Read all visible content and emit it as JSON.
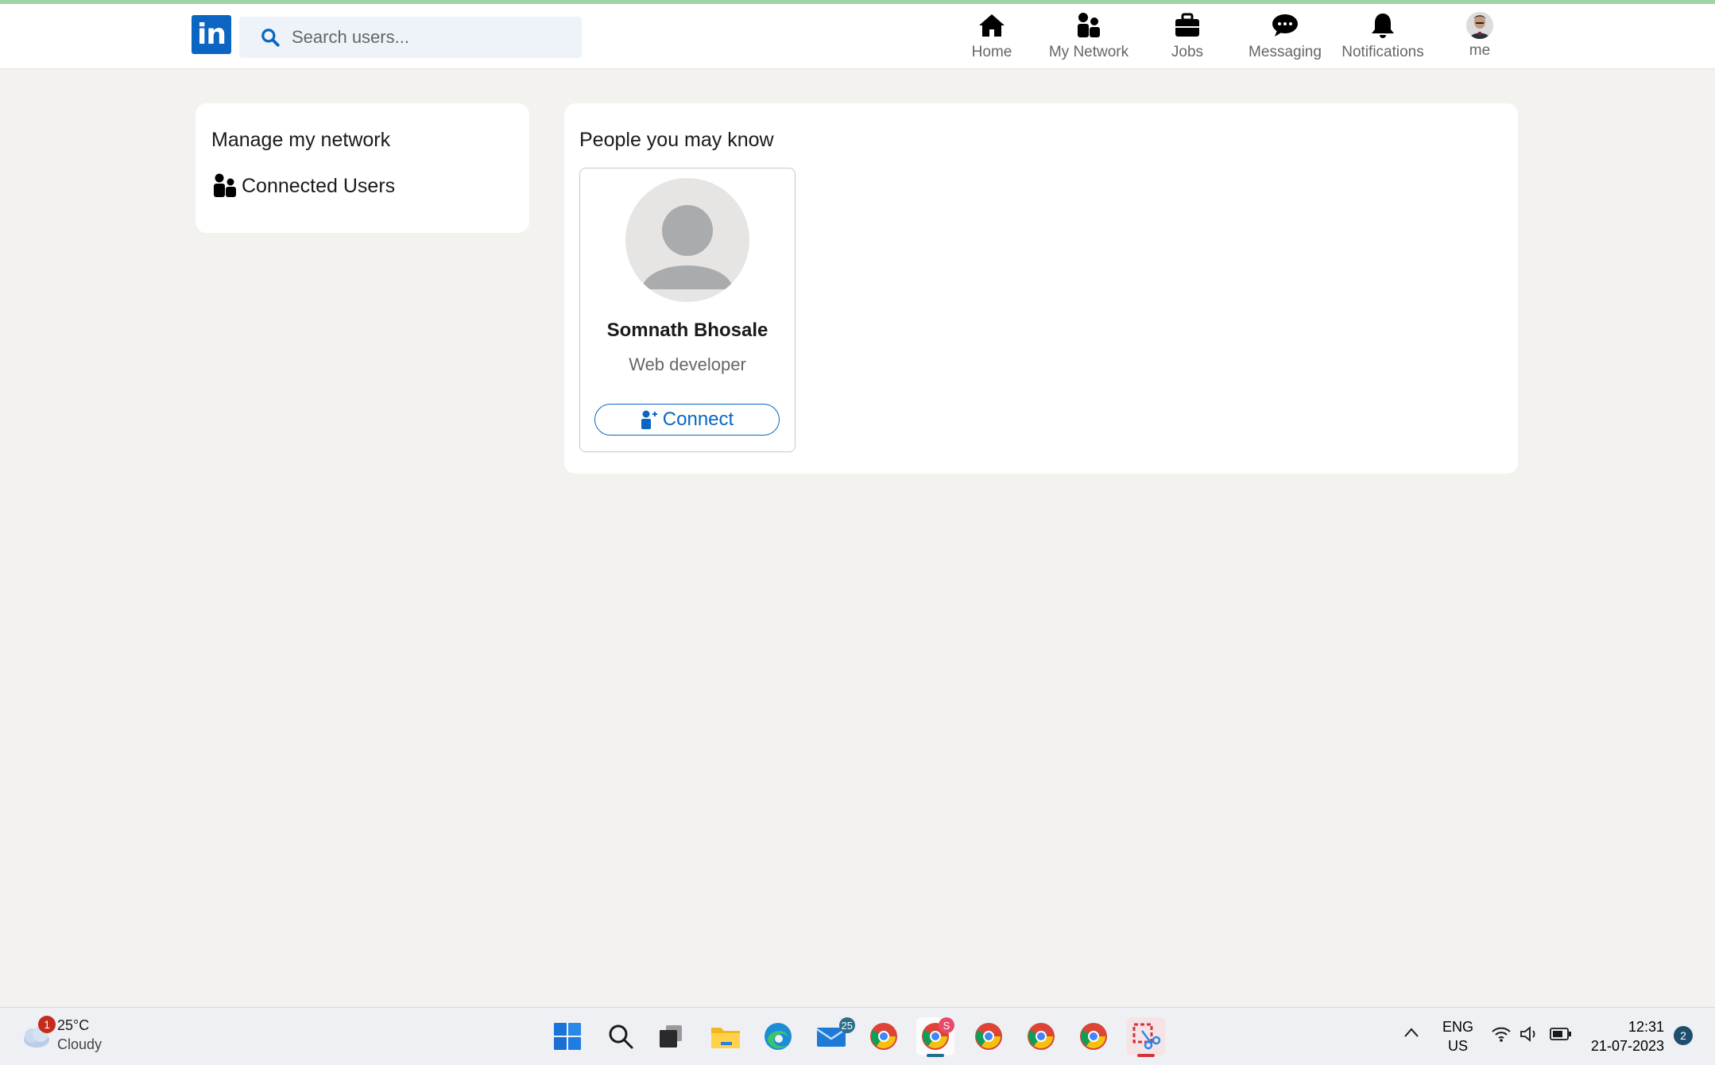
{
  "header": {
    "logo_text": "in",
    "search_placeholder": "Search users...",
    "nav": [
      {
        "label": "Home",
        "icon": "home-icon"
      },
      {
        "label": "My Network",
        "icon": "network-icon"
      },
      {
        "label": "Jobs",
        "icon": "briefcase-icon"
      },
      {
        "label": "Messaging",
        "icon": "message-icon"
      },
      {
        "label": "Notifications",
        "icon": "bell-icon"
      },
      {
        "label": "me",
        "icon": "avatar"
      }
    ]
  },
  "sidebar": {
    "title": "Manage my network",
    "connected_users_label": "Connected Users"
  },
  "main": {
    "title": "People you may know",
    "people": [
      {
        "name": "Somnath Bhosale",
        "role": "Web developer",
        "button_label": "Connect"
      }
    ]
  },
  "taskbar": {
    "weather": {
      "badge": "1",
      "temp": "25°C",
      "condition": "Cloudy"
    },
    "apps": [
      {
        "icon": "windows-start-icon"
      },
      {
        "icon": "search-icon"
      },
      {
        "icon": "task-view-icon"
      },
      {
        "icon": "file-explorer-icon"
      },
      {
        "icon": "edge-icon"
      },
      {
        "icon": "mail-icon",
        "badge": "25"
      },
      {
        "icon": "chrome-icon"
      },
      {
        "icon": "chrome-icon",
        "badge": "S",
        "active": true
      },
      {
        "icon": "chrome-icon"
      },
      {
        "icon": "chrome-icon"
      },
      {
        "icon": "chrome-icon"
      },
      {
        "icon": "snipping-tool-icon"
      }
    ],
    "lang_top": "ENG",
    "lang_bottom": "US",
    "time": "12:31",
    "date": "21-07-2023",
    "notification_count": "2"
  },
  "colors": {
    "brand": "#0a66c2",
    "background": "#f3f2ef",
    "card": "#ffffff"
  }
}
